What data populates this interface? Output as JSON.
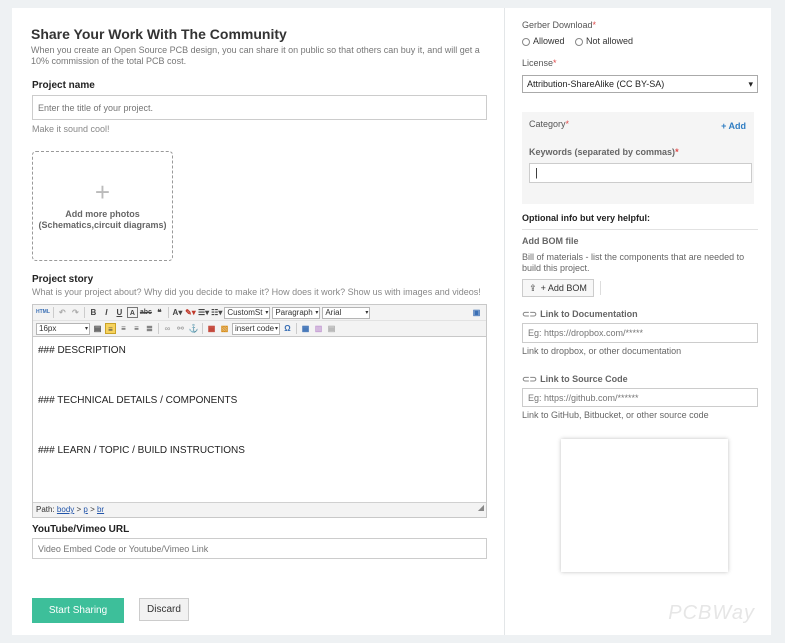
{
  "header": {
    "title": "Share Your Work With The Community",
    "description": "When you create an Open Source PCB design, you can share it on public so that others can buy it, and will get a 10% commission of the total PCB cost."
  },
  "project_name": {
    "label": "Project name",
    "placeholder": "Enter the title of your project.",
    "hint": "Make it sound cool!"
  },
  "photos": {
    "plus": "+",
    "line1": "Add more photos",
    "line2": "(Schematics,circuit diagrams)"
  },
  "story": {
    "label": "Project story",
    "hint": "What is your project about? Why did you decide to make it? How does it work? Show us with images and videos!",
    "toolbar": {
      "style_select": "CustomSt",
      "format_select": "Paragraph",
      "font_select": "Arial",
      "size_select": "16px",
      "insert_select": "insert code"
    },
    "content": [
      "### DESCRIPTION",
      "### TECHNICAL DETAILS / COMPONENTS",
      "### LEARN / TOPIC / BUILD INSTRUCTIONS"
    ],
    "status_path_label": "Path:",
    "status_path": [
      "body",
      "p",
      "br"
    ]
  },
  "video": {
    "label": "YouTube/Vimeo URL",
    "placeholder": "Video Embed Code or Youtube/Vimeo Link"
  },
  "actions": {
    "start": "Start Sharing",
    "discard": "Discard"
  },
  "sidebar": {
    "gerber": {
      "label": "Gerber Download",
      "required_mark": "*",
      "options": [
        "Allowed",
        "Not allowed"
      ]
    },
    "license": {
      "label": "License",
      "required_mark": "*",
      "value": "Attribution-ShareAlike (CC BY-SA)"
    },
    "category": {
      "label": "Category",
      "required_mark": "*",
      "add_label": "+ Add"
    },
    "keywords": {
      "label": "Keywords (separated by commas)",
      "required_mark": "*",
      "value": ""
    },
    "optional_heading": "Optional info but very helpful:",
    "bom": {
      "label": "Add BOM file",
      "description": "Bill of materials - list the components that are needed to build this project.",
      "button": "+ Add BOM"
    },
    "documentation": {
      "label": "Link to Documentation",
      "placeholder": "Eg: https://dropbox.com/*****",
      "hint": "Link to dropbox, or other documentation"
    },
    "source": {
      "label": "Link to Source Code",
      "placeholder": "Eg: https://github.com/******",
      "hint": "Link to GitHub, Bitbucket, or other source code"
    }
  },
  "watermark": "PCBWay",
  "colors": {
    "primary": "#3dbf9a",
    "link": "#2f7dc2",
    "required": "#e04a4a"
  }
}
